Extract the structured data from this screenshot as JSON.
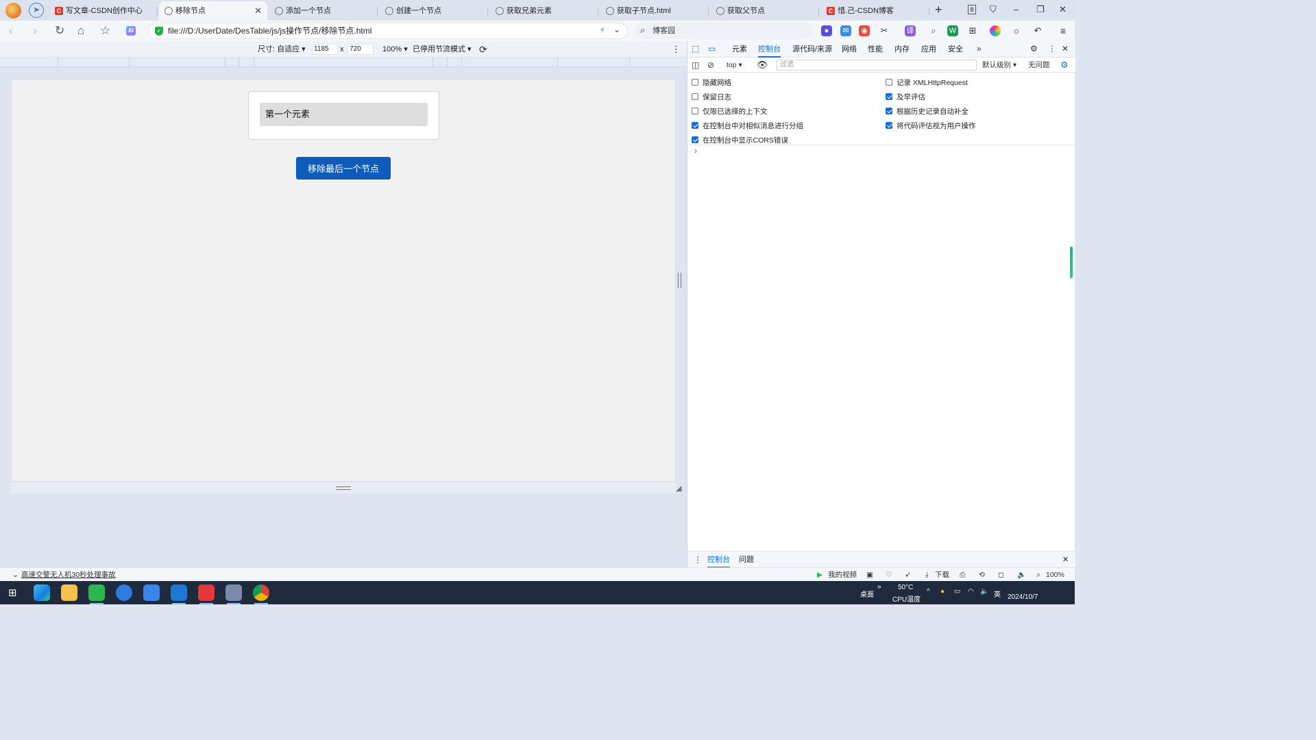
{
  "browser": {
    "tabs": [
      {
        "title": "写文章-CSDN创作中心",
        "favicon": "csdn-icon"
      },
      {
        "title": "移除节点",
        "favicon": "globe-icon",
        "active": true
      },
      {
        "title": "添加一个节点",
        "favicon": "globe-icon"
      },
      {
        "title": "创建一个节点",
        "favicon": "globe-icon"
      },
      {
        "title": "获取兄弟元素",
        "favicon": "globe-icon"
      },
      {
        "title": "获取子节点.html",
        "favicon": "globe-icon"
      },
      {
        "title": "获取父节点",
        "favicon": "globe-icon"
      },
      {
        "title": "惜.己-CSDN博客",
        "favicon": "csdn-icon"
      }
    ],
    "tab_count": "8",
    "url": "file:///D:/UserDate/DesTable/js/js操作节点/移除节点.html",
    "search_placeholder": "博客园"
  },
  "device_toolbar": {
    "size_label": "尺寸: 自适应 ▾",
    "width": "1185",
    "times": "x",
    "height": "720",
    "zoom": "100% ▾",
    "throttle": "已停用节流模式 ▾"
  },
  "page": {
    "list_items": [
      "第一个元素"
    ],
    "remove_button": "移除最后一个节点"
  },
  "devtools": {
    "tabs": [
      "元素",
      "控制台",
      "源代码/来源",
      "网络",
      "性能",
      "内存",
      "应用",
      "安全"
    ],
    "active_tab": "控制台",
    "context": "top ▾",
    "filter_placeholder": "过滤",
    "level": "默认级别 ▾",
    "issues": "无问题",
    "options_left": [
      {
        "label": "隐藏网络",
        "checked": false
      },
      {
        "label": "保留日志",
        "checked": false
      },
      {
        "label": "仅限已选择的上下文",
        "checked": false
      },
      {
        "label": "在控制台中对相似消息进行分组",
        "checked": true
      },
      {
        "label": "在控制台中显示CORS错误",
        "checked": true
      }
    ],
    "options_right": [
      {
        "label": "记录 XMLHttpRequest",
        "checked": false
      },
      {
        "label": "及早评估",
        "checked": true
      },
      {
        "label": "根据历史记录自动补全",
        "checked": true
      },
      {
        "label": "将代码评估视为用户操作",
        "checked": true
      }
    ],
    "drawer_tabs": [
      "控制台",
      "问题"
    ],
    "prompt": "›"
  },
  "statusbar": {
    "news": "高速交警无人机30秒处理事故",
    "my_video": "我的视频",
    "download": "下载",
    "zoom": "100%"
  },
  "taskbar": {
    "desktop": "桌面",
    "temp": "50°C",
    "temp_label": "CPU温度",
    "ime": "英",
    "date": "2024/10/7"
  },
  "colors": {
    "accent": "#1a6ed8",
    "button": "#0d5cbc",
    "taskbar": "#1f2a3c"
  }
}
